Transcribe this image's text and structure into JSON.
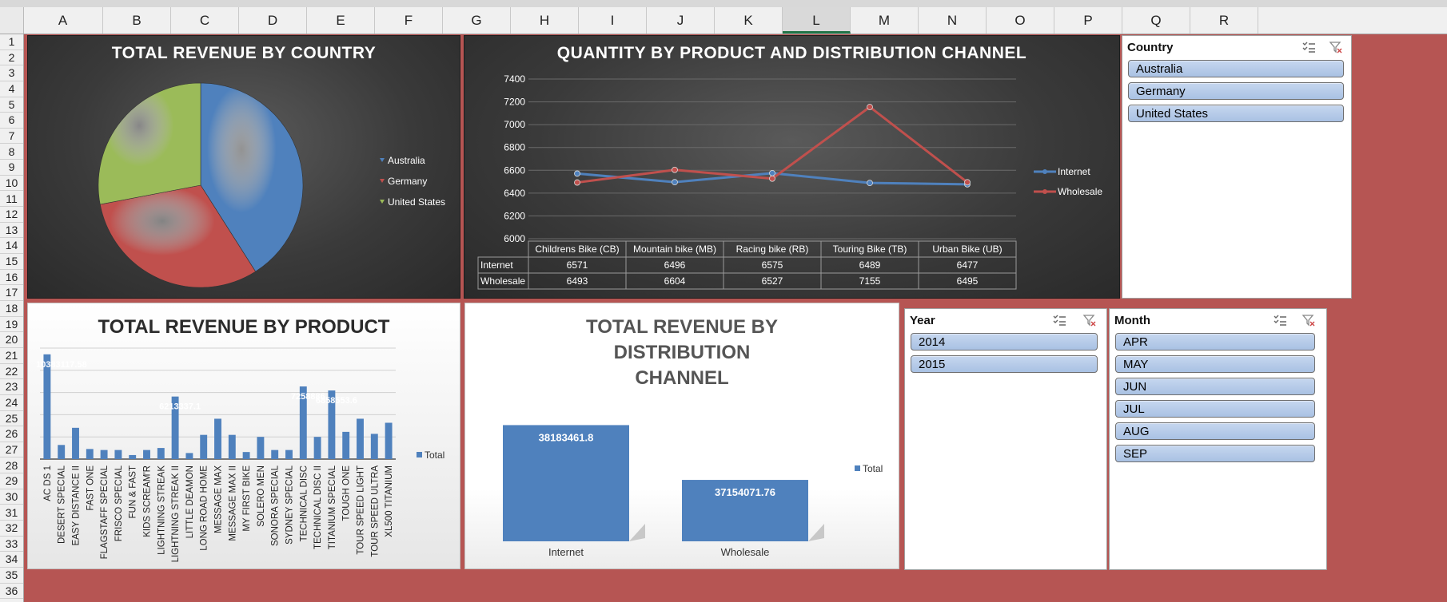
{
  "columns": [
    "A",
    "B",
    "C",
    "D",
    "E",
    "F",
    "G",
    "H",
    "I",
    "J",
    "K",
    "L",
    "M",
    "N",
    "O",
    "P",
    "Q",
    "R"
  ],
  "selected_column": "L",
  "rows": [
    "1",
    "2",
    "3",
    "4",
    "5",
    "6",
    "7",
    "8",
    "9",
    "10",
    "11",
    "12",
    "13",
    "14",
    "15",
    "16",
    "17",
    "18",
    "19",
    "20",
    "21",
    "22",
    "23",
    "24",
    "25",
    "26",
    "27",
    "28",
    "29",
    "30",
    "31",
    "32",
    "33",
    "34",
    "35",
    "36"
  ],
  "colors": {
    "sheet_background": "#b65553",
    "series_blue": "#4f81bd",
    "series_red": "#c0504d",
    "series_green": "#9bbb59",
    "slicer_item": "#b8cce4"
  },
  "slicers": {
    "country": {
      "title": "Country",
      "items": [
        "Australia",
        "Germany",
        "United States"
      ]
    },
    "year": {
      "title": "Year",
      "items": [
        "2014",
        "2015"
      ]
    },
    "month": {
      "title": "Month",
      "items": [
        "APR",
        "MAY",
        "JUN",
        "JUL",
        "AUG",
        "SEP"
      ]
    },
    "icons": [
      "multi-select-icon",
      "clear-filter-icon"
    ]
  },
  "chart_data": [
    {
      "type": "pie",
      "title": "TOTAL REVENUE BY COUNTRY",
      "categories": [
        "Australia",
        "Germany",
        "United States"
      ],
      "values": [
        41,
        31,
        28
      ],
      "legend": "right"
    },
    {
      "type": "line",
      "title": "QUANTITY BY PRODUCT AND DISTRIBUTION CHANNEL",
      "categories": [
        "Childrens Bike (CB)",
        "Mountain bike (MB)",
        "Racing bike (RB)",
        "Touring Bike (TB)",
        "Urban Bike (UB)"
      ],
      "series": [
        {
          "name": "Internet",
          "values": [
            6571,
            6496,
            6575,
            6489,
            6477
          ]
        },
        {
          "name": "Wholesale",
          "values": [
            6493,
            6604,
            6527,
            7155,
            6495
          ]
        }
      ],
      "yticks": [
        "7400",
        "7200",
        "7000",
        "6800",
        "6600",
        "6400",
        "6200",
        "6000"
      ],
      "ylim": [
        6000,
        7400
      ],
      "grid": true,
      "legend": "right",
      "data_table": true
    },
    {
      "type": "bar",
      "title": "TOTAL REVENUE BY PRODUCT",
      "categories": [
        "AC DS 1",
        "DESERT SPECIAL",
        "EASY DISTANCE II",
        "FAST ONE",
        "FLAGSTAFF SPECIAL",
        "FRISCO SPECIAL",
        "FUN & FAST",
        "KIDS SCREAM'R",
        "LIGHTNING STREAK",
        "LIGHTNING STREAK II",
        "LITTLE DEAMON",
        "LONG ROAD HOME",
        "MESSAGE MAX",
        "MESSAGE MAX II",
        "MY FIRST BIKE",
        "SOLERO MEN",
        "SONORA SPECIAL",
        "SYDNEY SPECIAL",
        "TECHNICAL DISC",
        "TECHNICAL DISC II",
        "TITANIUM SPECIAL",
        "TOUGH ONE",
        "TOUR SPEED LIGHT",
        "TOUR SPEED ULTRA",
        "XL500 TITANIUM"
      ],
      "series": [
        {
          "name": "Total",
          "values": [
            10383117.58,
            1400000,
            3100000,
            1000000,
            900000,
            900000,
            400000,
            900000,
            1100000,
            6200000,
            600000,
            2400000,
            4000000,
            2400000,
            700000,
            2200000,
            900000,
            900000,
            7200000,
            2200000,
            6800000,
            2700000,
            4000000,
            2500000,
            3600000
          ]
        }
      ],
      "data_labels": [
        "10383117.58",
        "6213337.1",
        "7258886",
        "6858553.6"
      ],
      "ylim": [
        0,
        11000000
      ],
      "grid": true,
      "legend": "right"
    },
    {
      "type": "bar",
      "title": "TOTAL REVENUE BY DISTRIBUTION CHANNEL",
      "categories": [
        "Internet",
        "Wholesale"
      ],
      "series": [
        {
          "name": "Total",
          "values": [
            38183461.8,
            37154071.76
          ]
        }
      ],
      "data_labels": [
        "38183461.8",
        "37154071.76"
      ],
      "ylim": [
        36000000,
        38700000
      ],
      "legend": "right"
    }
  ]
}
